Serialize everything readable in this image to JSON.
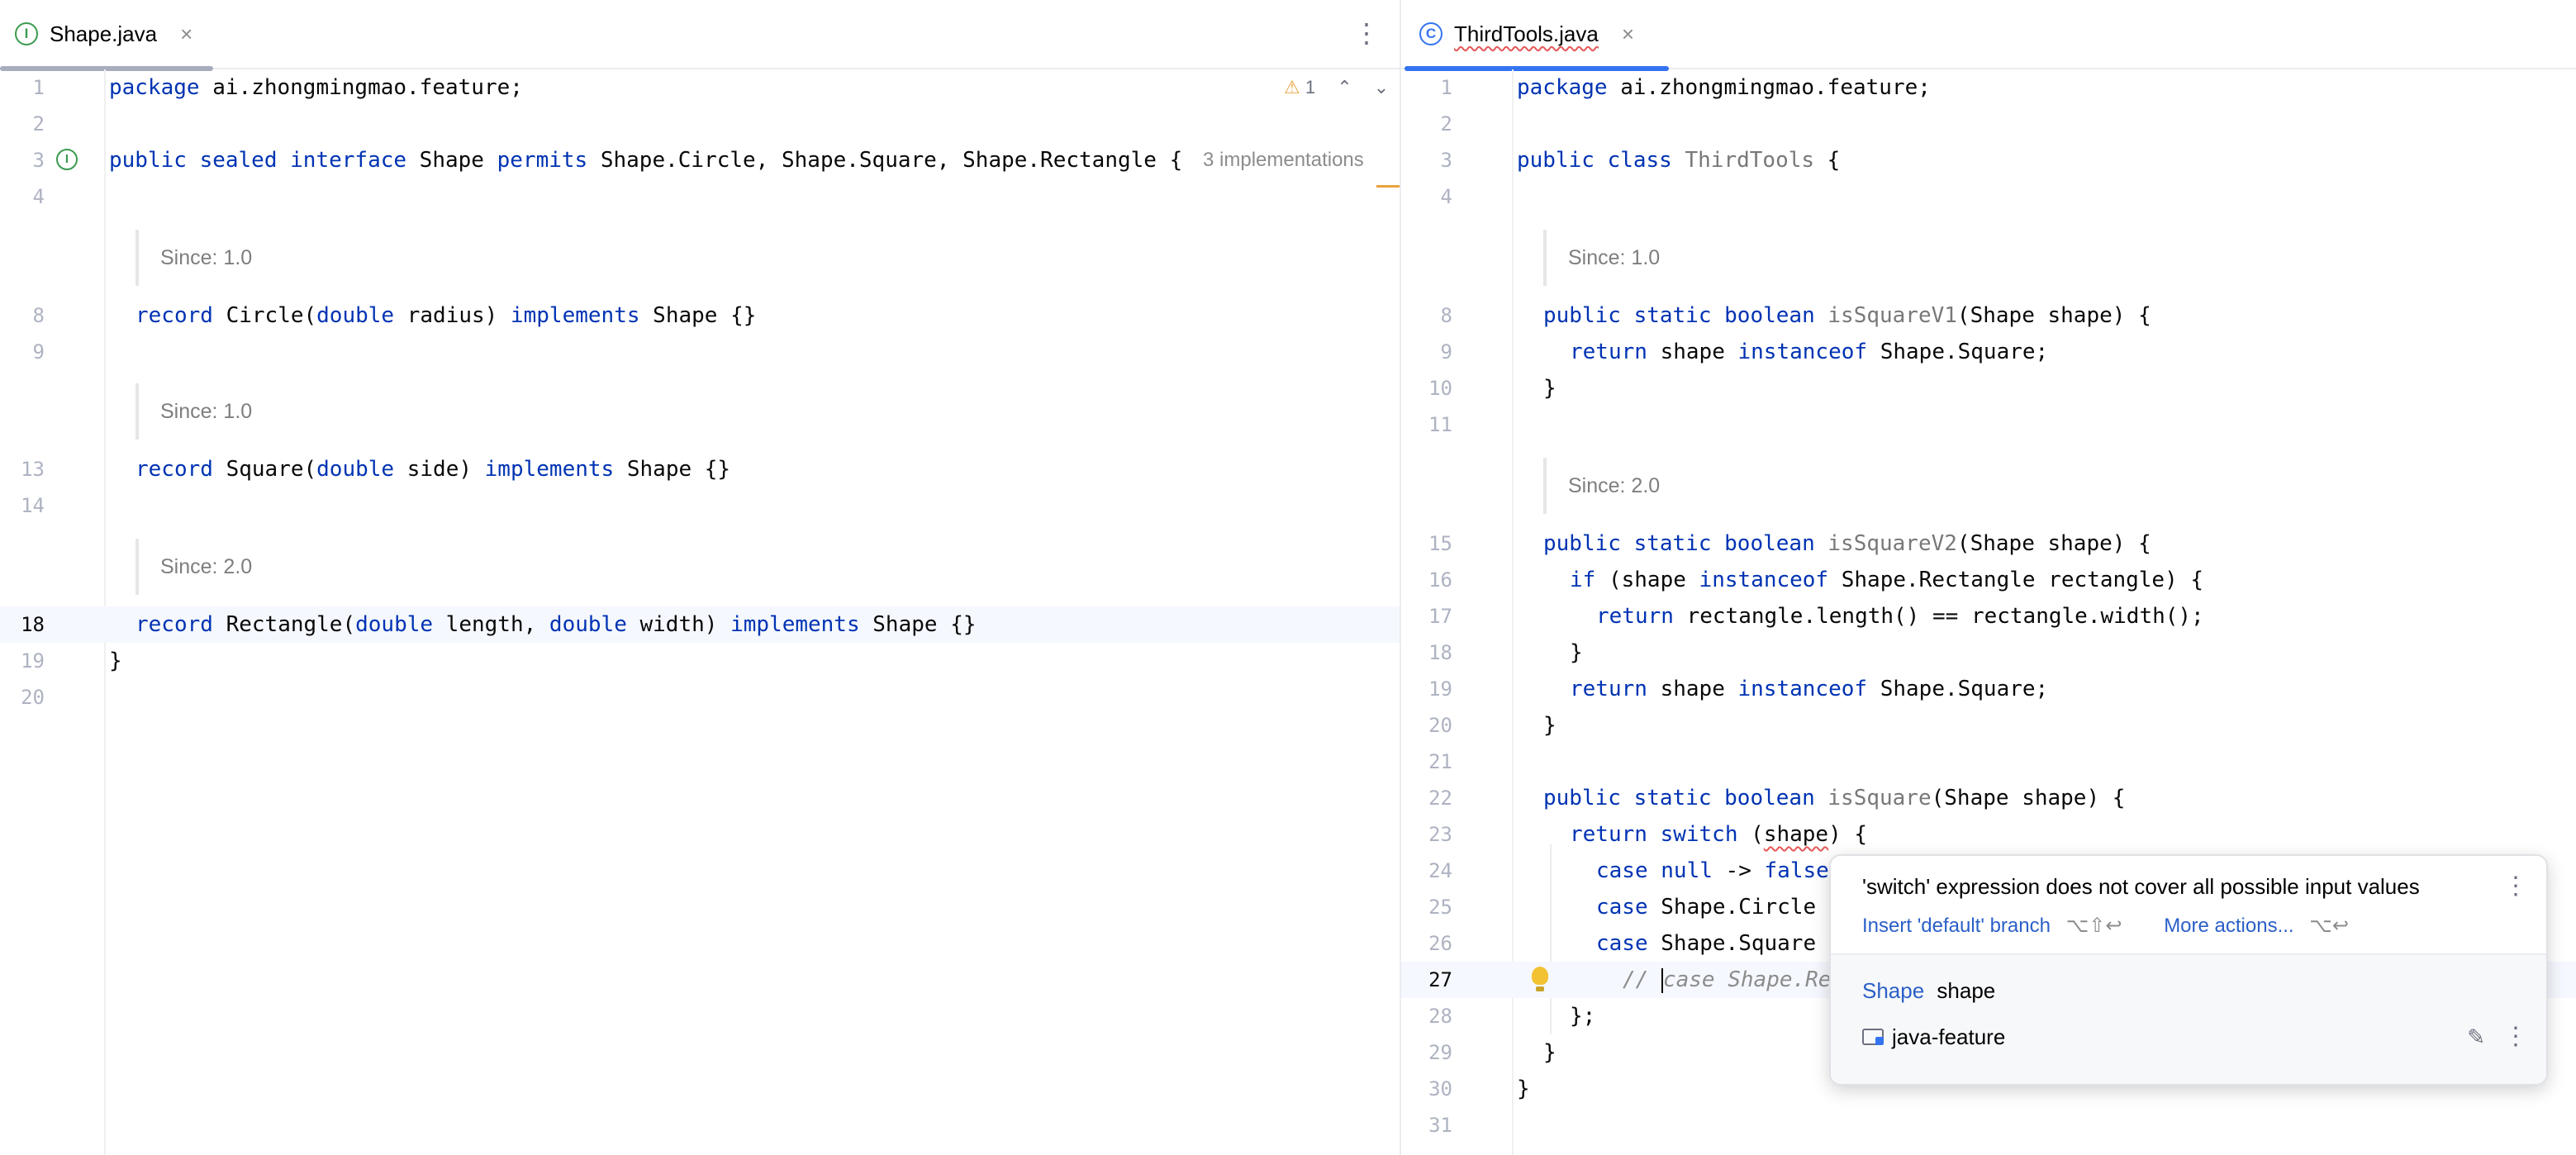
{
  "left": {
    "tab": {
      "icon": "interface-icon",
      "label": "Shape.java",
      "close": "×"
    },
    "menu_icon": "⋮",
    "lines": [
      {
        "n": "1"
      },
      {
        "n": "2"
      },
      {
        "n": "3"
      },
      {
        "n": "4"
      },
      {
        "n": "8"
      },
      {
        "n": "9"
      },
      {
        "n": "13"
      },
      {
        "n": "14"
      },
      {
        "n": "18"
      },
      {
        "n": "19"
      },
      {
        "n": "20"
      }
    ],
    "code": {
      "l1_kw": "package",
      "l1_rest": " ai.zhongmingmao.feature;",
      "l3_kw": "public sealed interface",
      "l3_name": " Shape ",
      "l3_kw2": "permits",
      "l3_rest": " Shape.Circle, Shape.Square, Shape.Rectangle {",
      "l8_kw": "record",
      "l8_a": " Circle(",
      "l8_kw2": "double",
      "l8_b": " radius) ",
      "l8_kw3": "implements",
      "l8_c": " Shape {}",
      "l13_kw": "record",
      "l13_a": " Square(",
      "l13_kw2": "double",
      "l13_b": " side) ",
      "l13_kw3": "implements",
      "l13_c": " Shape {}",
      "l18_kw": "record",
      "l18_a": " Rectangle(",
      "l18_kw2": "double",
      "l18_b": " length, ",
      "l18_kw3": "double",
      "l18_c": " width) ",
      "l18_kw4": "implements",
      "l18_d": " Shape {}",
      "l19": "}"
    },
    "docs": [
      "Since: 1.0",
      "Since: 1.0",
      "Since: 2.0"
    ],
    "inlay_hint": "3 implementations",
    "warnings": {
      "icon": "warning-icon",
      "count": "1"
    }
  },
  "right": {
    "tab": {
      "icon": "class-icon",
      "label": "ThirdTools.java",
      "close": "×"
    },
    "lines": [
      {
        "n": "1"
      },
      {
        "n": "2"
      },
      {
        "n": "3"
      },
      {
        "n": "4"
      },
      {
        "n": "8"
      },
      {
        "n": "9"
      },
      {
        "n": "10"
      },
      {
        "n": "11"
      },
      {
        "n": "15"
      },
      {
        "n": "16"
      },
      {
        "n": "17"
      },
      {
        "n": "18"
      },
      {
        "n": "19"
      },
      {
        "n": "20"
      },
      {
        "n": "21"
      },
      {
        "n": "22"
      },
      {
        "n": "23"
      },
      {
        "n": "24"
      },
      {
        "n": "25"
      },
      {
        "n": "26"
      },
      {
        "n": "27"
      },
      {
        "n": "28"
      },
      {
        "n": "29"
      },
      {
        "n": "30"
      },
      {
        "n": "31"
      }
    ],
    "code": {
      "l1_kw": "package",
      "l1_rest": " ai.zhongmingmao.feature;",
      "l3_kw": "public class",
      "l3_name": " ThirdTools",
      "l3_rest": " {",
      "l8_kw": "public static boolean",
      "l8_fn": " isSquareV1",
      "l8_rest": "(Shape shape) {",
      "l9_kw": "return",
      "l9_a": " shape ",
      "l9_kw2": "instanceof",
      "l9_b": " Shape.Square;",
      "l10": "}",
      "l15_kw": "public static boolean",
      "l15_fn": " isSquareV2",
      "l15_rest": "(Shape shape) {",
      "l16_kw": "if",
      "l16_a": " (shape ",
      "l16_kw2": "instanceof",
      "l16_b": " Shape.Rectangle rectangle) {",
      "l17_kw": "return",
      "l17_a": " rectangle.length() == rectangle.width();",
      "l18": "}",
      "l19_kw": "return",
      "l19_a": " shape ",
      "l19_kw2": "instanceof",
      "l19_b": " Shape.Square;",
      "l20": "}",
      "l22_kw": "public static boolean",
      "l22_fn": " isSquare",
      "l22_rest": "(Shape shape) {",
      "l23_kw": "return switch",
      "l23_a": " (",
      "l23_err": "shape",
      "l23_b": ") {",
      "l24_kw": "case null",
      "l24_a": " -> ",
      "l24_kw2": "false",
      "l25_kw": "case",
      "l25_a": " Shape.Circle",
      "l26_kw": "case",
      "l26_a": " Shape.Square",
      "l27_cmt_a": "// ",
      "l27_cmt_b": "case Shape.Re",
      "l28": "};",
      "l29": "}",
      "l30": "}"
    },
    "docs": [
      "Since: 1.0",
      "Since: 2.0"
    ]
  },
  "popup": {
    "message": "'switch' expression does not cover all possible input values",
    "fix_label": "Insert 'default' branch",
    "fix_shortcut": "⌥⇧↩",
    "more_label": "More actions...",
    "more_shortcut": "⌥↩",
    "symbol_type": "Shape",
    "symbol_name": "shape",
    "module": "java-feature"
  },
  "colors": {
    "keyword": "#0033b3",
    "method": "#787878",
    "accent": "#3574f0",
    "error": "#e55757",
    "interface_icon": "#3a9b4e"
  }
}
